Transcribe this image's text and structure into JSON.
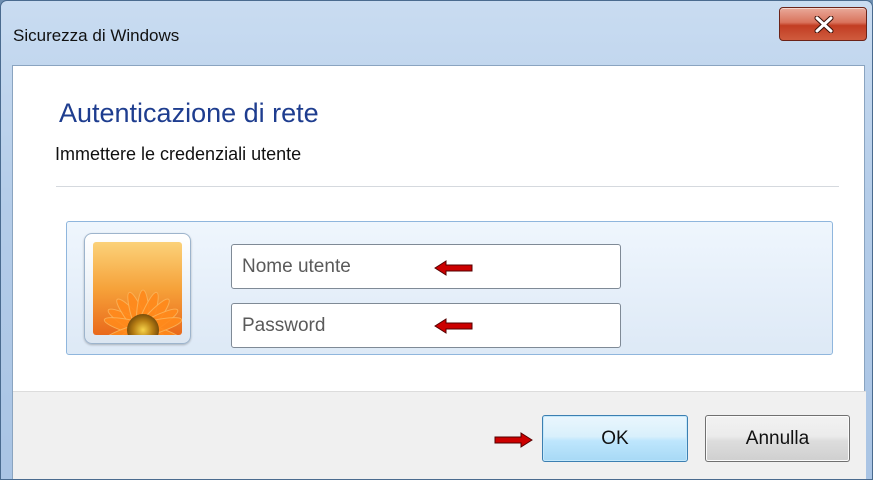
{
  "window": {
    "title": "Sicurezza di Windows",
    "close_icon": "close-icon"
  },
  "dialog": {
    "heading": "Autenticazione di rete",
    "subheading": "Immettere le credenziali utente"
  },
  "credentials": {
    "avatar_icon": "flower-avatar",
    "username": {
      "value": "",
      "placeholder": "Nome utente"
    },
    "password": {
      "value": "",
      "placeholder": "Password"
    }
  },
  "annotations": {
    "arrow_icon": "red-arrow-icon",
    "arrow_color": "#cc0000"
  },
  "buttons": {
    "ok_label": "OK",
    "cancel_label": "Annulla"
  },
  "colors": {
    "heading": "#1e3d8f",
    "close_button": "#c23d22",
    "panel_border": "#8fb6dd"
  }
}
